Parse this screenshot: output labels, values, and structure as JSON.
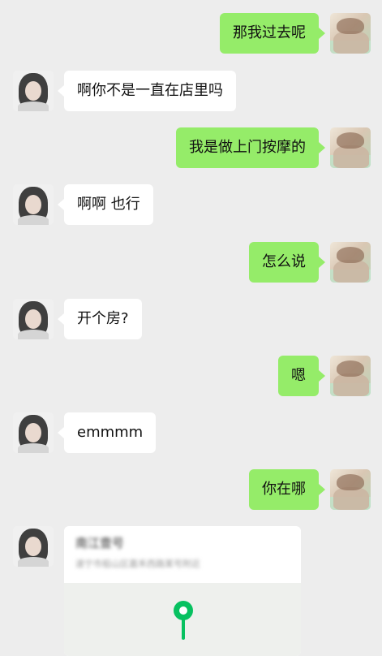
{
  "messages": [
    {
      "side": "out",
      "text": "那我过去呢"
    },
    {
      "side": "in",
      "text": "啊你不是一直在店里吗"
    },
    {
      "side": "out",
      "text": "我是做上门按摩的"
    },
    {
      "side": "in",
      "text": "啊啊 也行"
    },
    {
      "side": "out",
      "text": "怎么说"
    },
    {
      "side": "in",
      "text": "开个房?"
    },
    {
      "side": "out",
      "text": "嗯"
    },
    {
      "side": "in",
      "text": "emmmm"
    },
    {
      "side": "out",
      "text": "你在哪"
    }
  ],
  "location_card": {
    "name": "南江壹号",
    "address": "遂宁市船山区嘉禾西路某号附近",
    "pin_icon": "map-pin-icon",
    "accent": "#07c160"
  },
  "colors": {
    "background": "#ededed",
    "outgoing_bubble": "#95ec69",
    "incoming_bubble": "#ffffff"
  }
}
